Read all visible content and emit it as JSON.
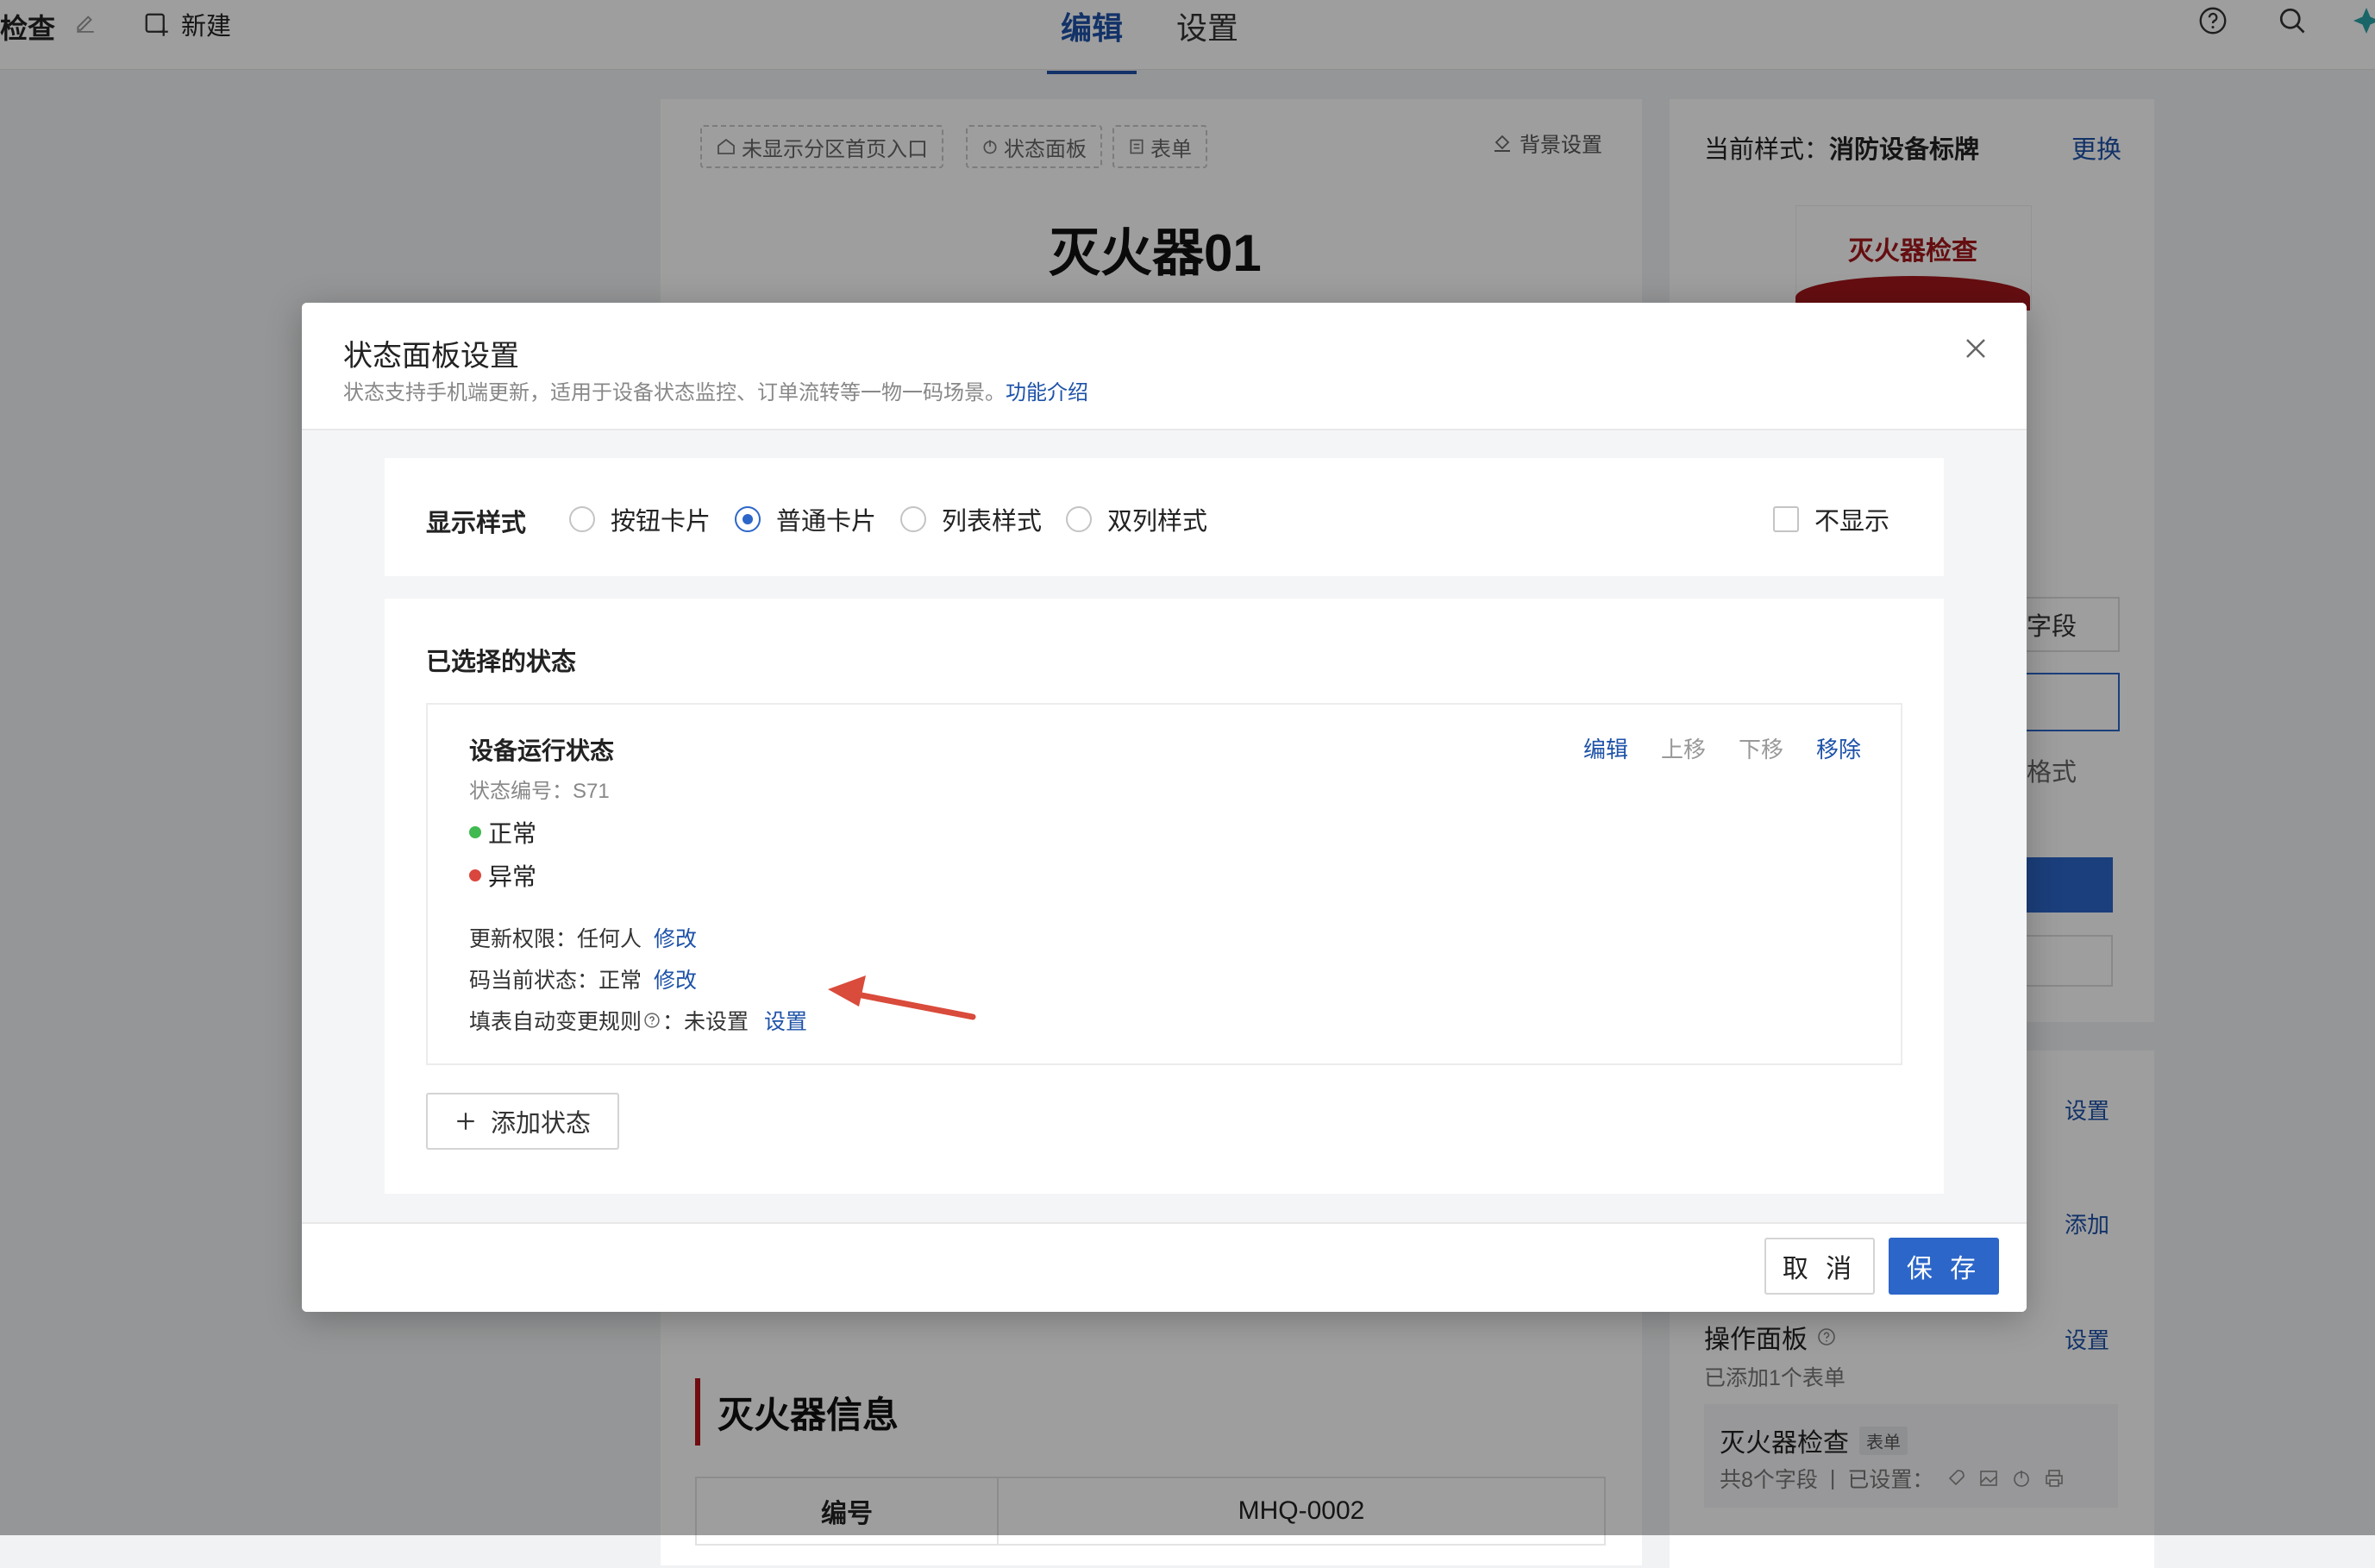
{
  "topbar": {
    "app_title": "检查",
    "new_label": "新建",
    "tabs": [
      {
        "label": "编辑"
      },
      {
        "label": "设置"
      }
    ],
    "active_tab": "编辑"
  },
  "editor": {
    "chips": [
      "未显示分区首页入口",
      "状态面板",
      "表单"
    ],
    "background_setting": "背景设置",
    "doc_title": "灭火器01",
    "info_section_title": "灭火器信息",
    "info_rows": [
      {
        "key": "编号",
        "value": "MHQ-0002"
      }
    ]
  },
  "right_panel": {
    "style_label": "当前样式：",
    "style_name": "消防设备标牌",
    "change_link": "更换",
    "sign_text": "灭火器检查",
    "field_label": "字段",
    "format_label": "格式",
    "links": [
      "设置",
      "添加",
      "设置"
    ],
    "operation_panel": {
      "title": "操作面板",
      "subtitle": "已添加1个表单",
      "card_title": "灭火器检查",
      "card_tag": "表单",
      "card_fields": "共8个字段",
      "card_settings": "已设置："
    }
  },
  "modal": {
    "title": "状态面板设置",
    "description": "状态支持手机端更新，适用于设备状态监控、订单流转等一物一码场景。",
    "description_link": "功能介绍",
    "display_style": {
      "label": "显示样式",
      "options": [
        "按钮卡片",
        "普通卡片",
        "列表样式",
        "双列样式"
      ],
      "selected": "普通卡片",
      "hide_label": "不显示",
      "hide_checked": false
    },
    "selected_states": {
      "label": "已选择的状态",
      "state": {
        "name": "设备运行状态",
        "code": "状态编号：S71",
        "actions": [
          "编辑",
          "上移",
          "下移",
          "移除"
        ],
        "options": [
          {
            "label": "正常",
            "color": "#3fb950"
          },
          {
            "label": "异常",
            "color": "#d9463e"
          }
        ],
        "meta": [
          {
            "label": "更新权限：任何人",
            "link": "修改"
          },
          {
            "label": "码当前状态：正常",
            "link": "修改"
          },
          {
            "label": "填表自动变更规则",
            "value": "：未设置",
            "link": "设置"
          }
        ]
      },
      "add_button": "添加状态"
    },
    "cancel_label": "取 消",
    "save_label": "保 存"
  },
  "colors": {
    "accent": "#2c66c8",
    "brand_red": "#a3171c",
    "annotation_arrow": "#d94b3b"
  }
}
